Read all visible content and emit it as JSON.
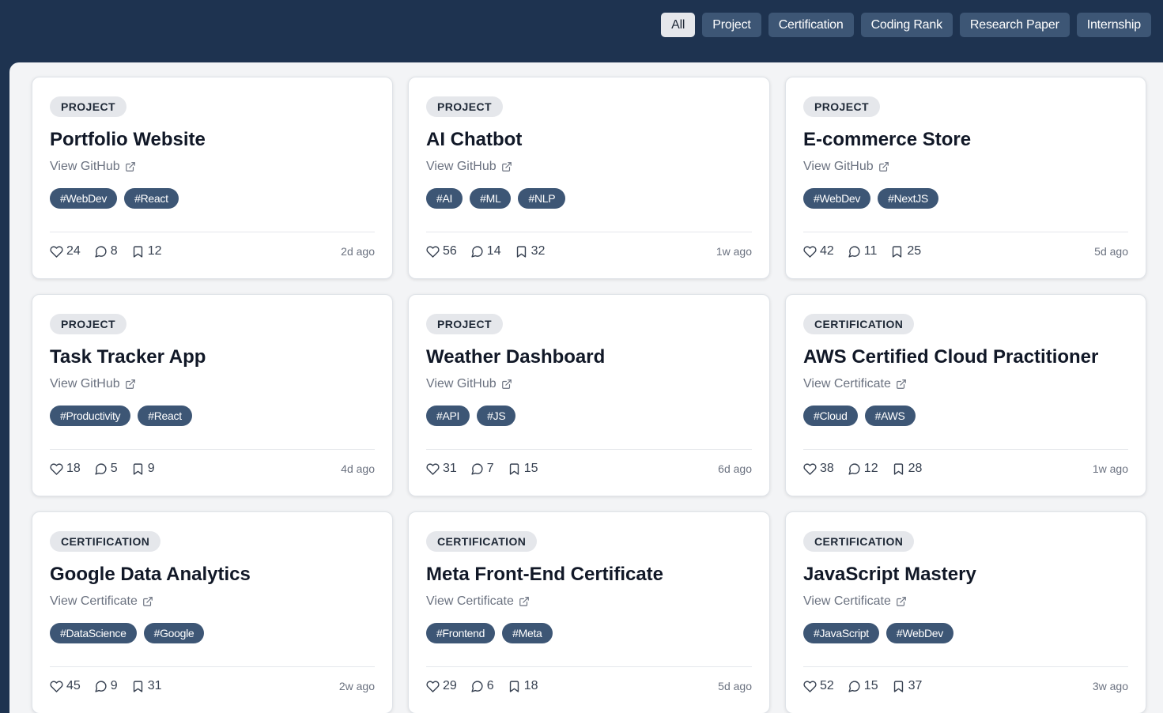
{
  "filters": [
    {
      "label": "All",
      "active": true
    },
    {
      "label": "Project",
      "active": false
    },
    {
      "label": "Certification",
      "active": false
    },
    {
      "label": "Coding Rank",
      "active": false
    },
    {
      "label": "Research Paper",
      "active": false
    },
    {
      "label": "Internship",
      "active": false
    }
  ],
  "cards": [
    {
      "type": "PROJECT",
      "title": "Portfolio Website",
      "link": "View GitHub",
      "tags": [
        "#WebDev",
        "#React"
      ],
      "likes": "24",
      "comments": "8",
      "saves": "12",
      "time": "2d ago"
    },
    {
      "type": "PROJECT",
      "title": "AI Chatbot",
      "link": "View GitHub",
      "tags": [
        "#AI",
        "#ML",
        "#NLP"
      ],
      "likes": "56",
      "comments": "14",
      "saves": "32",
      "time": "1w ago"
    },
    {
      "type": "PROJECT",
      "title": "E-commerce Store",
      "link": "View GitHub",
      "tags": [
        "#WebDev",
        "#NextJS"
      ],
      "likes": "42",
      "comments": "11",
      "saves": "25",
      "time": "5d ago"
    },
    {
      "type": "PROJECT",
      "title": "Task Tracker App",
      "link": "View GitHub",
      "tags": [
        "#Productivity",
        "#React"
      ],
      "likes": "18",
      "comments": "5",
      "saves": "9",
      "time": "4d ago"
    },
    {
      "type": "PROJECT",
      "title": "Weather Dashboard",
      "link": "View GitHub",
      "tags": [
        "#API",
        "#JS"
      ],
      "likes": "31",
      "comments": "7",
      "saves": "15",
      "time": "6d ago"
    },
    {
      "type": "CERTIFICATION",
      "title": "AWS Certified Cloud Practitioner",
      "link": "View Certificate",
      "tags": [
        "#Cloud",
        "#AWS"
      ],
      "likes": "38",
      "comments": "12",
      "saves": "28",
      "time": "1w ago"
    },
    {
      "type": "CERTIFICATION",
      "title": "Google Data Analytics",
      "link": "View Certificate",
      "tags": [
        "#DataScience",
        "#Google"
      ],
      "likes": "45",
      "comments": "9",
      "saves": "31",
      "time": "2w ago"
    },
    {
      "type": "CERTIFICATION",
      "title": "Meta Front-End Certificate",
      "link": "View Certificate",
      "tags": [
        "#Frontend",
        "#Meta"
      ],
      "likes": "29",
      "comments": "6",
      "saves": "18",
      "time": "5d ago"
    },
    {
      "type": "CERTIFICATION",
      "title": "JavaScript Mastery",
      "link": "View Certificate",
      "tags": [
        "#JavaScript",
        "#WebDev"
      ],
      "likes": "52",
      "comments": "15",
      "saves": "37",
      "time": "3w ago"
    }
  ],
  "icons": {
    "like": "heart-icon",
    "comment": "comment-icon",
    "save": "bookmark-icon",
    "link": "external-link-icon"
  },
  "colors": {
    "header_bg": "#1e3350",
    "chip_bg": "#3d5675",
    "active_chip_bg": "#e5e7eb",
    "panel_bg": "#f3f4f6"
  }
}
